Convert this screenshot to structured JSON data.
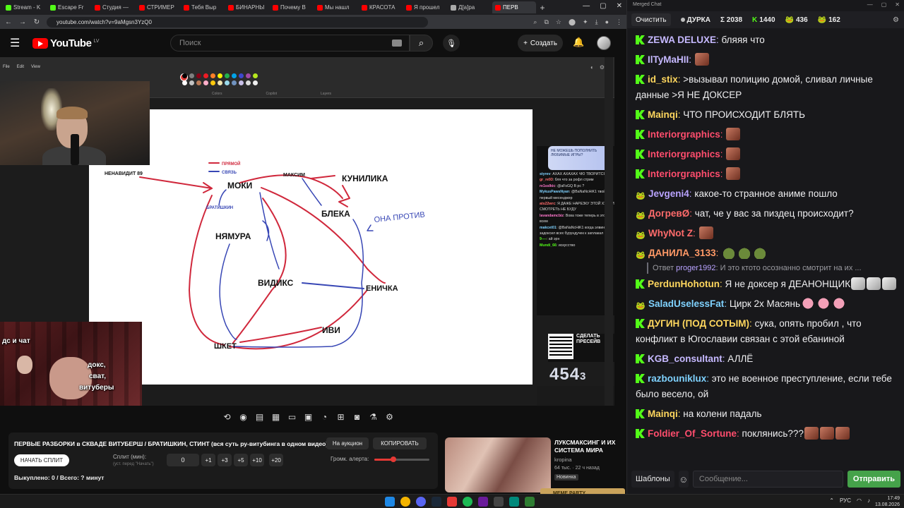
{
  "browser": {
    "tabs": [
      {
        "label": "Stream - K",
        "color": "#53fc18"
      },
      {
        "label": "Escape Fr",
        "color": "#53fc18"
      },
      {
        "label": "Студия —",
        "color": "#ff0000"
      },
      {
        "label": "СТРИМЕР",
        "color": "#ff0000"
      },
      {
        "label": "Тебя Выр",
        "color": "#ff0000"
      },
      {
        "label": "БИНАРНЫ",
        "color": "#ff0000"
      },
      {
        "label": "Почему В",
        "color": "#ff0000"
      },
      {
        "label": "Мы нашл",
        "color": "#ff0000"
      },
      {
        "label": "КРАСОТА",
        "color": "#ff0000"
      },
      {
        "label": "Я прошел",
        "color": "#ff0000"
      },
      {
        "label": "Д[а]ра",
        "color": "#aaaaaa"
      },
      {
        "label": "ПЕРВ",
        "color": "#ff0000",
        "active": true
      }
    ],
    "new_tab": "+",
    "url": "youtube.com/watch?v=9aMgsn3YzQ0"
  },
  "youtube": {
    "logo_text": "YouTube",
    "country_code": "LV",
    "search_placeholder": "Поиск",
    "create_label": "Создать"
  },
  "drawing": {
    "legend_primary": "ПРЯМОЙ",
    "legend_link": "СВЯЗЬ",
    "labels": {
      "hates": "НЕНАВИДИТ 89",
      "moki": "МОКИ",
      "bratishkin": "БРАТИШКИН",
      "nyamura": "НЯМУРА",
      "maksim": "МАКСИМ",
      "kunilika": "КУНИЛИКА",
      "bleka": "БЛЕКА",
      "ona_protiv": "ОНА ПРОТИВ",
      "vidiks": "ВИДИКС",
      "enichka": "ЕНИЧКА",
      "ivi": "ИВИ",
      "shket": "ШКЕТ"
    }
  },
  "overlay": {
    "reactor_caption_left": "дс и чат",
    "reactor_caption_right": [
      "докс,",
      "сват,",
      "витуберы"
    ],
    "sticker_text": "НЕ МОЖЕШЬ ПОПОЛНИТЬ ЛЮБИМЫЕ ИГРЫ?",
    "mini_chat": [
      {
        "name": "styrev",
        "text": "АХАХ АХАХАХ ЧЮ ТВОРИТСЯ",
        "color": "#7fd2ff"
      },
      {
        "name": "gr_re93",
        "text": "бля что за рофл стрим",
        "color": "#ff6b6b"
      },
      {
        "name": "re1ssIkic",
        "text": "@aFsGQ В рс ?",
        "color": "#ff77cc"
      },
      {
        "name": "MykusPawsNyan",
        "text": "@BaNaNcHiK1 твой первый месенджер",
        "color": "#7fd2ff"
      },
      {
        "name": "ats22wrc",
        "text": "Я ДАЖЕ НАРЕЗКУ ЭТОЙ ХУЙНИ СМОТРЕТЬ НЕ БУДУ",
        "color": "#ff6b6b"
      },
      {
        "name": "lavandamcbiz",
        "text": "Вова тоже теперь в этом всем",
        "color": "#ff77cc"
      },
      {
        "name": "makcet01",
        "text": "@BaNaNcHiK1 когда элвин задоксил всех бурундучек к заплакал",
        "color": "#7fd2ff"
      },
      {
        "name": "9----",
        "text": "ай эрн",
        "color": "#53fc18"
      },
      {
        "name": "Mundi_66",
        "text": "искусство",
        "color": "#53fc18"
      }
    ],
    "qr_caption": [
      "СДЕЛАТЬ",
      "ПРЕСЕЙВ"
    ],
    "counter_main": "454",
    "counter_small": "3"
  },
  "controls": {
    "auction_title": "ПЕРВЫЕ РАЗБОРКИ в СКВАДЕ ВИТУБЕРШ / БРАТИШКИН, СТИНТ (вся суть ру-витубинга в одном видео)",
    "auction_button": "На аукцион",
    "copy_button": "КОПИРОВАТЬ",
    "start_split": "НАЧАТЬ СПЛИТ",
    "split_label": "Сплит (мин):",
    "split_hint": "(уст. перед \"Начать\")",
    "split_value": "0",
    "steps": [
      "+1",
      "+3",
      "+5",
      "+10",
      "+20"
    ],
    "alert_volume_label": "Громк. алерта:",
    "alert_volume_level": 0.35,
    "bought": "Выкуплено: 0 / Всего: ? минут"
  },
  "recommendation": {
    "title": "ЛУКСМАКСИНГ И ИХ СИСТЕМА МИРА",
    "channel": "kropina",
    "meta": "64 тыс. · 22 ч назад",
    "badge": "Новинка",
    "meme_party": "MEME PARTY"
  },
  "chat": {
    "window_title": "Merged Chat",
    "clear_button": "Очистить",
    "stats": [
      {
        "label": "ДУРКА"
      },
      {
        "label": "Σ 2038"
      },
      {
        "label": "1440"
      },
      {
        "label": "436"
      },
      {
        "label": "162"
      }
    ],
    "messages": [
      {
        "platform": "k",
        "author": "ZEWA DELUXE",
        "color": "#c6b9ff",
        "text": "бляяя что"
      },
      {
        "platform": "k",
        "author": "IlTyMaHII",
        "color": "#c6b9ff",
        "text": "",
        "emotes": 1
      },
      {
        "platform": "k",
        "author": "id_stix",
        "color": "#ffd75e",
        "text": ">вызывал полицию домой, сливал личные данные >Я НЕ ДОКСЕР"
      },
      {
        "platform": "k",
        "author": "Mainqi",
        "color": "#ffd75e",
        "text": "ЧТО ПРОИСХОДИТ БЛЯТЬ"
      },
      {
        "platform": "k",
        "author": "Interiorgraphics",
        "color": "#ff4d6d",
        "text": "",
        "emotes": 1
      },
      {
        "platform": "k",
        "author": "Interiorgraphics",
        "color": "#ff4d6d",
        "text": "",
        "emotes": 1
      },
      {
        "platform": "k",
        "author": "Interiorgraphics",
        "color": "#ff4d6d",
        "text": "",
        "emotes": 1
      },
      {
        "platform": "t",
        "author": "Jevgeni4",
        "color": "#b9a3ff",
        "text": "какое-то странное аниме пошло"
      },
      {
        "platform": "t",
        "author": "ДогревØ",
        "color": "#ff6b6b",
        "text": "чат, че у вас за пиздец происходит?"
      },
      {
        "platform": "t",
        "author": "WhyNot Z",
        "color": "#ff6b6b",
        "text": "",
        "emotes": 1
      },
      {
        "platform": "t",
        "author": "ДАНИЛА_3133",
        "color": "#ff9966",
        "text": "",
        "emotes": 3,
        "emote_kind": "frog"
      },
      {
        "reply": true,
        "reply_prefix": "Ответ",
        "reply_to": "proger1992",
        "reply_text": ": И это ктото осознанно смотрит на их ..."
      },
      {
        "platform": "k",
        "author": "PerdunHohotun",
        "color": "#ffd75e",
        "text": "Я не доксер я ДЕАНОНЩИК",
        "emotes": 3,
        "emote_kind": "shake"
      },
      {
        "platform": "t",
        "author": "SaladUselessFat",
        "color": "#7fd2ff",
        "text": "Цирк 2х Масянь",
        "emotes": 3,
        "emote_kind": "pig"
      },
      {
        "platform": "k",
        "author": "ДУГИН (ПОД СОТЫМ)",
        "color": "#ffd75e",
        "text": "сука, опять пробил , что конфликт в Югославии связан с этой ебаниной"
      },
      {
        "platform": "k",
        "author": "KGB_consultant",
        "color": "#c6b9ff",
        "text": "АЛЛЁ"
      },
      {
        "platform": "k",
        "author": "razbouniklux",
        "color": "#7fd2ff",
        "text": "это не военное преступление, если тебе было весело, ой"
      },
      {
        "platform": "k",
        "author": "Mainqi",
        "color": "#ffd75e",
        "text": "на колени падаль"
      },
      {
        "platform": "k",
        "author": "Foldier_Of_Sortune",
        "color": "#ff4d6d",
        "text": "поклянись???",
        "emotes": 3
      }
    ],
    "templates_button": "Шаблоны",
    "input_placeholder": "Сообщение...",
    "send_button": "Отправить"
  },
  "taskbar": {
    "lang": "РУС",
    "time": "17:49",
    "date": "13.08.2026"
  }
}
